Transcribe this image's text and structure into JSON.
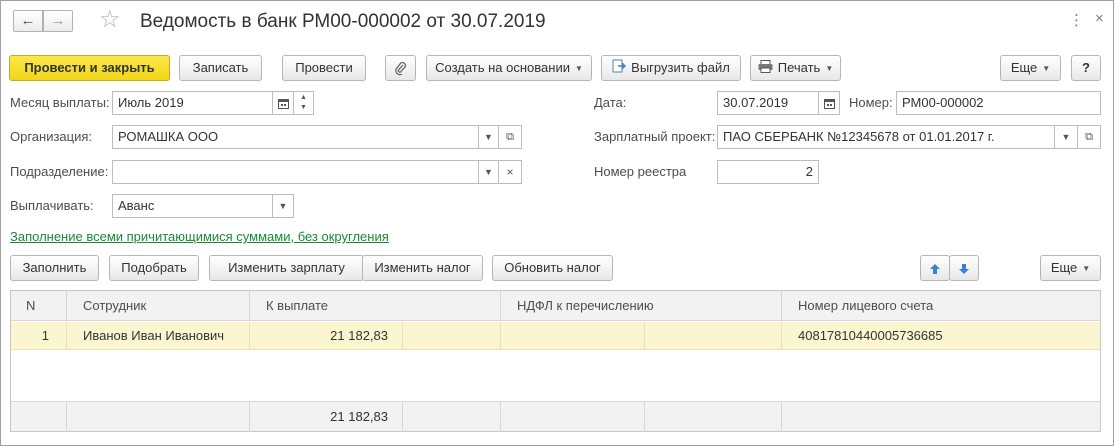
{
  "window": {
    "title": "Ведомость в банк РМ00-000002 от 30.07.2019",
    "back_icon": "←",
    "forward_icon": "→",
    "menu_icon": "⋮",
    "close_icon": "×"
  },
  "toolbar": {
    "post_close": "Провести и закрыть",
    "save": "Записать",
    "post": "Провести",
    "create_based": "Создать на основании",
    "export_file": "Выгрузить файл",
    "print": "Печать",
    "more": "Еще",
    "help": "?"
  },
  "form": {
    "month_label": "Месяц выплаты:",
    "month_value": "Июль 2019",
    "date_label": "Дата:",
    "date_value": "30.07.2019",
    "number_label": "Номер:",
    "number_value": "РМ00-000002",
    "org_label": "Организация:",
    "org_value": "РОМАШКА ООО",
    "project_label": "Зарплатный проект:",
    "project_value": "ПАО СБЕРБАНК №12345678 от 01.01.2017 г.",
    "dept_label": "Подразделение:",
    "dept_value": "",
    "registry_label": "Номер реестра",
    "registry_value": "2",
    "pay_label": "Выплачивать:",
    "pay_value": "Аванс"
  },
  "fill_link": "Заполнение всеми причитающимися суммами, без округления",
  "table_toolbar": {
    "fill": "Заполнить",
    "pick": "Подобрать",
    "change_salary": "Изменить зарплату",
    "change_tax": "Изменить налог",
    "update_tax": "Обновить налог",
    "more": "Еще"
  },
  "table": {
    "columns": [
      "N",
      "Сотрудник",
      "К выплате",
      "НДФЛ к перечислению",
      "Номер лицевого счета"
    ],
    "rows": [
      {
        "n": "1",
        "employee": "Иванов Иван Иванович",
        "amount": "21 182,83",
        "ndfl": "",
        "account": "40817810440005736685"
      }
    ],
    "footer_total": "21 182,83"
  },
  "colors": {
    "primary_button": "#f2d619",
    "selected_row": "#fbf6d0",
    "link": "#1a8a34",
    "arrow_icon": "#3d7fd1"
  }
}
